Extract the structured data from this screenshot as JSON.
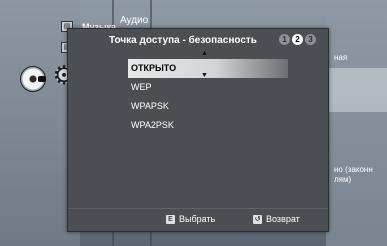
{
  "background": {
    "menu_label": "Музыка",
    "audio_label": "Аудио",
    "right_text_top": "ная",
    "right_text_bottom_1": "но (законн",
    "right_text_bottom_2": "лям)"
  },
  "icons": {
    "disc": "disc-icon",
    "gear": "gear-icon",
    "small1": "small-box-icon",
    "small2": "small-box-icon"
  },
  "popup": {
    "title": "Точка доступа - безопасность",
    "steps": [
      {
        "label": "1",
        "active": false
      },
      {
        "label": "2",
        "active": true
      },
      {
        "label": "3",
        "active": false
      }
    ],
    "options": [
      {
        "label": "ОТКРЫТО",
        "selected": true
      },
      {
        "label": "WEP",
        "selected": false
      },
      {
        "label": "WPAPSK",
        "selected": false
      },
      {
        "label": "WPA2PSK",
        "selected": false
      }
    ],
    "arrow_up": "▲",
    "arrow_down": "▼",
    "footer": {
      "select_key": "E",
      "select_label": "Выбрать",
      "back_key": "↺",
      "back_label": "Возврат"
    }
  },
  "colors": {
    "popup_bg": "#4b4f53",
    "selection": "#e7e8e9",
    "badge_active": "#ffffff",
    "badge_inactive": "#8d9196"
  }
}
